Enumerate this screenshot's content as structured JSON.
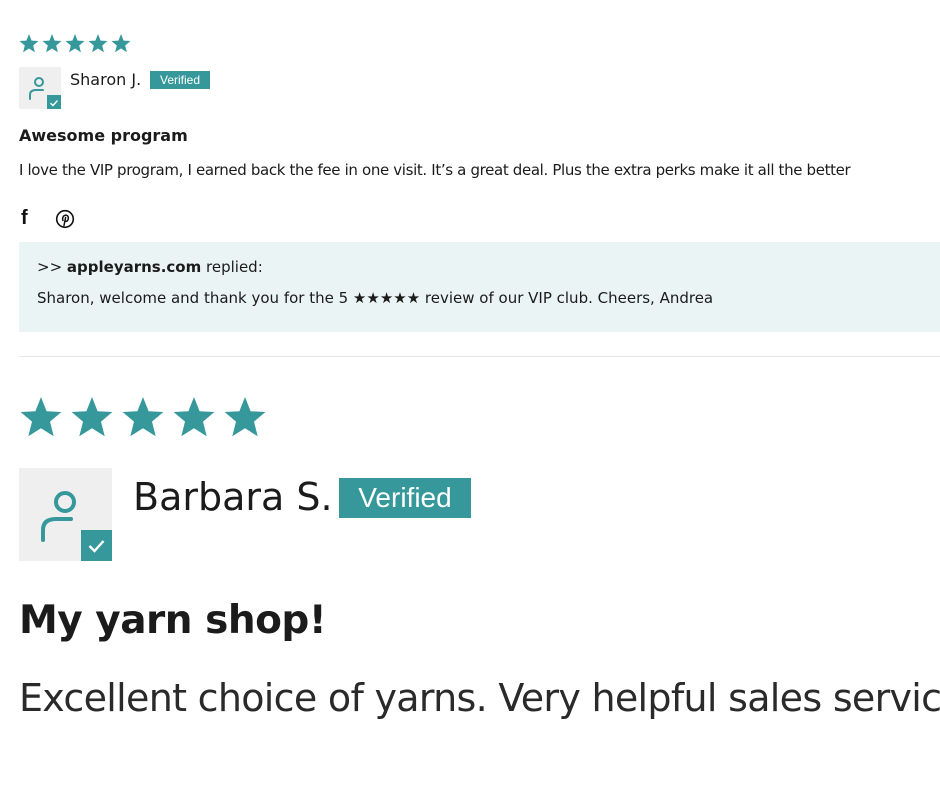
{
  "colors": {
    "accent": "#36989a",
    "reply_bg": "#ebf4f4",
    "avatar_bg": "#efefef",
    "text": "#1b1b1b"
  },
  "reviews": [
    {
      "rating": 5,
      "author": "Sharon J.",
      "badge": "Verified",
      "title": "Awesome program",
      "body": "I love the VIP program, I earned back the fee in one visit. It’s a great deal. Plus the extra perks make it all the better",
      "share_icons": [
        "facebook-icon",
        "pinterest-icon"
      ],
      "reply": {
        "prefix": ">> ",
        "store": "appleyarns.com",
        "verb": " replied:",
        "text": "Sharon, welcome and thank you for the 5 ★★★★★ review of our VIP club. Cheers, Andrea"
      }
    },
    {
      "rating": 5,
      "author": "Barbara S.",
      "badge": "Verified",
      "title": "My yarn shop!",
      "body": "Excellent choice of yarns. Very helpful sales service."
    }
  ]
}
